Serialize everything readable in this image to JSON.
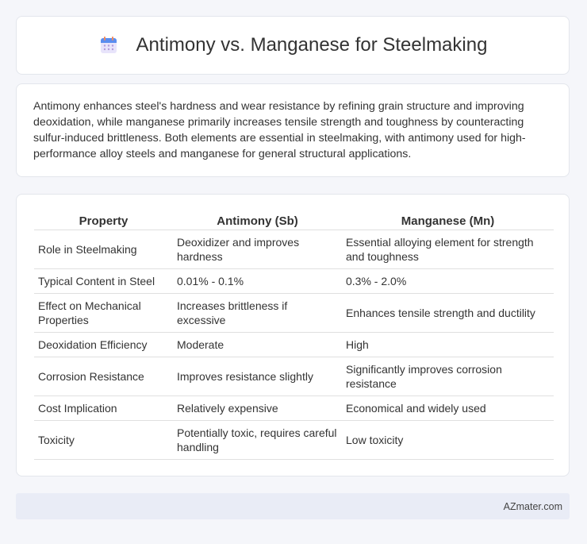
{
  "header": {
    "title": "Antimony vs. Manganese for Steelmaking",
    "icon": "calendar-icon"
  },
  "summary": {
    "text": "Antimony enhances steel's hardness and wear resistance by refining grain structure and improving deoxidation, while manganese primarily increases tensile strength and toughness by counteracting sulfur-induced brittleness. Both elements are essential in steelmaking, with antimony used for high-performance alloy steels and manganese for general structural applications."
  },
  "table": {
    "headers": [
      "Property",
      "Antimony (Sb)",
      "Manganese (Mn)"
    ],
    "rows": [
      [
        "Role in Steelmaking",
        "Deoxidizer and improves hardness",
        "Essential alloying element for strength and toughness"
      ],
      [
        "Typical Content in Steel",
        "0.01% - 0.1%",
        "0.3% - 2.0%"
      ],
      [
        "Effect on Mechanical Properties",
        "Increases brittleness if excessive",
        "Enhances tensile strength and ductility"
      ],
      [
        "Deoxidation Efficiency",
        "Moderate",
        "High"
      ],
      [
        "Corrosion Resistance",
        "Improves resistance slightly",
        "Significantly improves corrosion resistance"
      ],
      [
        "Cost Implication",
        "Relatively expensive",
        "Economical and widely used"
      ],
      [
        "Toxicity",
        "Potentially toxic, requires careful handling",
        "Low toxicity"
      ]
    ]
  },
  "footer": {
    "brand": "AZmater.com"
  }
}
